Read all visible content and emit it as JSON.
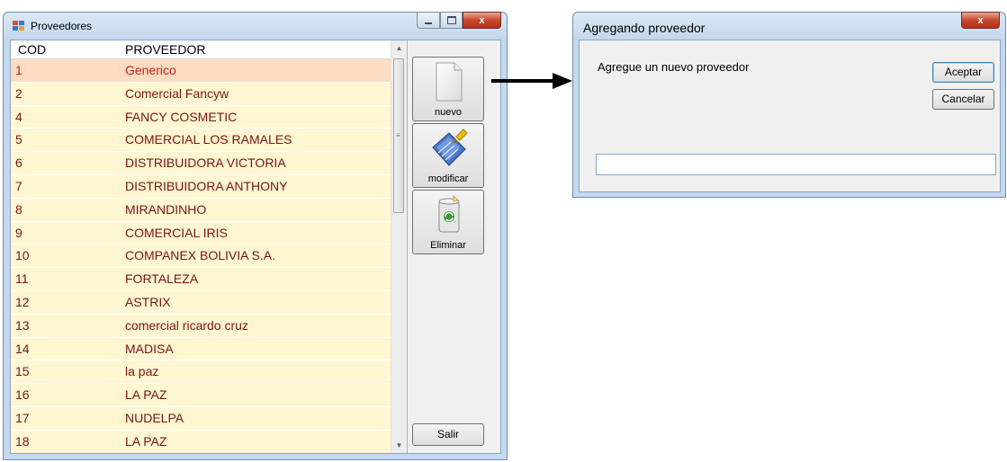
{
  "main_window": {
    "title": "Proveedores",
    "columns": {
      "cod": "COD",
      "proveedor": "PROVEEDOR"
    },
    "rows": [
      {
        "cod": "1",
        "name": "Generico",
        "selected": true
      },
      {
        "cod": "2",
        "name": "Comercial Fancyw"
      },
      {
        "cod": "4",
        "name": "FANCY COSMETIC"
      },
      {
        "cod": "5",
        "name": "COMERCIAL LOS RAMALES"
      },
      {
        "cod": "6",
        "name": "DISTRIBUIDORA VICTORIA"
      },
      {
        "cod": "7",
        "name": "DISTRIBUIDORA ANTHONY"
      },
      {
        "cod": "8",
        "name": "MIRANDINHO"
      },
      {
        "cod": "9",
        "name": "COMERCIAL IRIS"
      },
      {
        "cod": "10",
        "name": "COMPANEX BOLIVIA S.A."
      },
      {
        "cod": "11",
        "name": "FORTALEZA"
      },
      {
        "cod": "12",
        "name": "ASTRIX"
      },
      {
        "cod": "13",
        "name": "comercial ricardo cruz"
      },
      {
        "cod": "14",
        "name": "MADISA"
      },
      {
        "cod": "15",
        "name": "la paz"
      },
      {
        "cod": "16",
        "name": "LA PAZ"
      },
      {
        "cod": "17",
        "name": "NUDELPA"
      },
      {
        "cod": "18",
        "name": "LA PAZ"
      }
    ],
    "buttons": {
      "nuevo": "nuevo",
      "modificar": "modificar",
      "eliminar": "Eliminar",
      "salir": "Salir"
    },
    "caption": {
      "close": "x"
    },
    "icons": {
      "nuevo": "new-document-icon",
      "modificar": "edit-brush-icon",
      "eliminar": "recycle-bin-icon",
      "app": "app-grid-icon"
    }
  },
  "dialog": {
    "title": "Agregando proveedor",
    "prompt": "Agregue un nuevo proveedor",
    "ok": "Aceptar",
    "cancel": "Cancelar",
    "input_value": "",
    "caption": {
      "close": "x"
    }
  },
  "colors": {
    "row_bg": "#fff6d2",
    "row_selected_bg": "#fcdcc2",
    "row_text": "#7a1414",
    "row_selected_text": "#c42020",
    "titlebar": "#c4d9ee"
  }
}
